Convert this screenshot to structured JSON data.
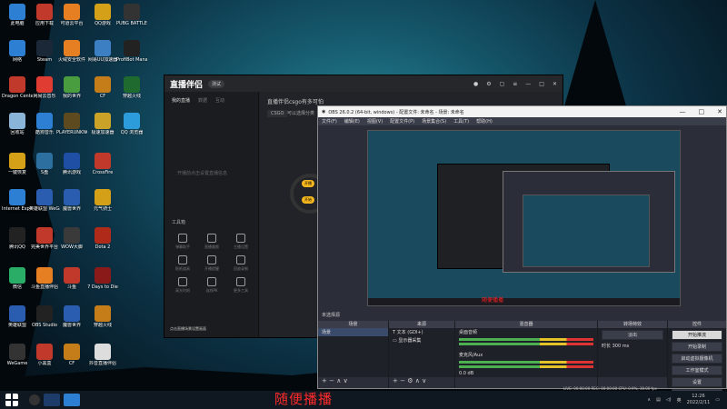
{
  "desktop_icons": [
    {
      "label": "此电脑",
      "color": "#2d7fd3"
    },
    {
      "label": "应用下载",
      "color": "#c0392b"
    },
    {
      "label": "可道云平台",
      "color": "#e67e22"
    },
    {
      "label": "QQ游戏",
      "color": "#d4a017"
    },
    {
      "label": "PUBG BATTLEG...",
      "color": "#333"
    },
    {
      "label": "网络",
      "color": "#2d7fd3"
    },
    {
      "label": "Steam",
      "color": "#1b2838"
    },
    {
      "label": "火绒安全软件",
      "color": "#e67e22"
    },
    {
      "label": "网易UU加速器",
      "color": "#3c7fc3"
    },
    {
      "label": "ProfiBot Manag...",
      "color": "#222"
    },
    {
      "label": "Dragon Center",
      "color": "#c0392b"
    },
    {
      "label": "网易云音乐",
      "color": "#e03c31"
    },
    {
      "label": "我的世界",
      "color": "#4a9d3f"
    },
    {
      "label": "CF",
      "color": "#c57d1a"
    },
    {
      "label": "穿越火线",
      "color": "#1f6a2e"
    },
    {
      "label": "回收站",
      "color": "#8ab4d8"
    },
    {
      "label": "酷狗音乐",
      "color": "#2d7fd3"
    },
    {
      "label": "PLAYERUNKNOWN'S BATTLEGR...",
      "color": "#5d4a1f"
    },
    {
      "label": "极速加速器",
      "color": "#c9a227"
    },
    {
      "label": "QQ 浏览器",
      "color": "#2d9cdb"
    },
    {
      "label": "一键恢复",
      "color": "#d4a017"
    },
    {
      "label": "S盘",
      "color": "#2d6f9f"
    },
    {
      "label": "腾讯游戏",
      "color": "#1f4fa5"
    },
    {
      "label": "CrossFire",
      "color": "#c0392b"
    },
    {
      "label": "Internet Explorer",
      "color": "#2d7fd3"
    },
    {
      "label": "英雄联盟 WeGame版",
      "color": "#2a5db0"
    },
    {
      "label": "魔兽世界",
      "color": "#2a5db0"
    },
    {
      "label": "元气骑士",
      "color": "#d4a017"
    },
    {
      "label": "腾讯QQ",
      "color": "#222"
    },
    {
      "label": "完美世界平台",
      "color": "#c0392b"
    },
    {
      "label": "WOW大脚",
      "color": "#3a3a3a"
    },
    {
      "label": "Dota 2",
      "color": "#b02a1a"
    },
    {
      "label": "微信",
      "color": "#2aae67"
    },
    {
      "label": "斗鱼直播伴侣",
      "color": "#e67e22"
    },
    {
      "label": "斗鱼",
      "color": "#c0392b"
    },
    {
      "label": "7 Days to Die",
      "color": "#8a1a1a"
    },
    {
      "label": "英雄联盟",
      "color": "#2a5db0"
    },
    {
      "label": "OBS Studio",
      "color": "#222"
    },
    {
      "label": "魔兽世界",
      "color": "#2a5db0"
    },
    {
      "label": "穿越火线",
      "color": "#c57d1a"
    },
    {
      "label": "WeGame",
      "color": "#333"
    },
    {
      "label": "小黑盒",
      "color": "#c0392b"
    },
    {
      "label": "CF",
      "color": "#c57d1a"
    },
    {
      "label": "抖音直播伴侣",
      "color": "#ddd"
    }
  ],
  "zhibo": {
    "logo": "直播伴侣",
    "version": "测试",
    "tabs": [
      "我的直播",
      "数据",
      "互动"
    ],
    "hint": "开播前点击设置直播信息",
    "tools_title": "工具箱",
    "tools": [
      "弹幕助手",
      "直播美颜",
      "主播设置",
      "贴纸道具",
      "开播提醒",
      "回放录制",
      "高光时刻",
      "连线PK",
      "更多工具"
    ],
    "note": "点击直播场景设置画面",
    "title": "直播伴侣csgo有多可怕",
    "category": "CSGO",
    "category2": "可以选择分类",
    "scene_text": "开播",
    "scene_text2": "开始"
  },
  "obs": {
    "title": "OBS 26.0.2 (64-bit, windows) - 配置文件: 未命名 - 场景: 未命名",
    "menu": [
      "文件(F)",
      "编辑(E)",
      "视图(V)",
      "配置文件(P)",
      "场景集合(S)",
      "工具(T)",
      "帮助(H)"
    ],
    "preview_label": "随便播播",
    "subbar": "未选择源",
    "docks": {
      "scenes": {
        "title": "场景",
        "items": [
          "场景"
        ]
      },
      "sources": {
        "title": "来源",
        "items": [
          "文本 (GDI+)",
          "显示器采集"
        ]
      },
      "mixer": {
        "title": "混音器",
        "items": [
          "桌面音频",
          "麦克风/Aux"
        ],
        "db": "0.0 dB"
      },
      "transitions": {
        "title": "转场特效",
        "type": "淡出",
        "duration_label": "时长",
        "duration": "300 ms"
      },
      "controls": {
        "title": "控件",
        "buttons": [
          "开始推流",
          "开始录制",
          "启动虚拟摄像机",
          "工作室模式",
          "设置",
          "退出"
        ]
      }
    },
    "status": "LIVE: 00:00:00   REC: 00:00:00   CPU: 0.9%, 30.00 fps"
  },
  "taskbar": {
    "time": "12:26",
    "date": "2022/2/11",
    "lang": "英"
  },
  "overlay_text": "随便播播"
}
